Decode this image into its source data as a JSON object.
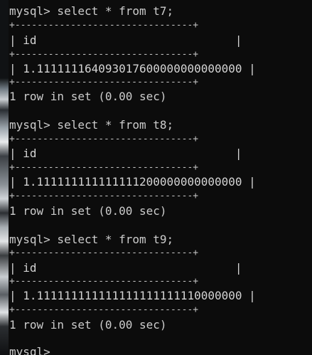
{
  "terminal": {
    "blocks": [
      {
        "prompt": "mysql> select * from t7;",
        "border": "+--------------------------------+",
        "header": "| id                             |",
        "value": "| 1.111111164093017600000000000000 |",
        "result": "1 row in set (0.00 sec)"
      },
      {
        "prompt": "mysql> select * from t8;",
        "border": "+--------------------------------+",
        "header": "| id                             |",
        "value": "| 1.111111111111111200000000000000 |",
        "result": "1 row in set (0.00 sec)"
      },
      {
        "prompt": "mysql> select * from t9;",
        "border": "+--------------------------------+",
        "header": "| id                             |",
        "value": "| 1.111111111111111111111110000000 |",
        "result": "1 row in set (0.00 sec)"
      }
    ],
    "final_prompt": "mysql>"
  }
}
